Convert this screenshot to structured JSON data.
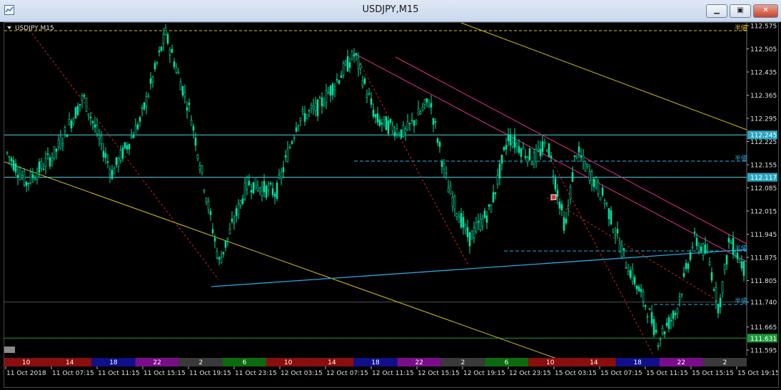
{
  "window": {
    "title": "USDJPY,M15",
    "minimize_icon": "minimize-icon",
    "maximize_icon": "restore-icon",
    "close_icon": "close-icon"
  },
  "chart": {
    "symbol_label": "USDJPY,M15",
    "colors": {
      "background": "#000000",
      "bull": "#00e0a0",
      "bear": "#00e0a0",
      "hline": "#4fd6e6",
      "trend_blue": "#2aa7e0",
      "channel_pink": "#e0308a",
      "channel_yellow": "#d8c020",
      "fib_red": "#d02020",
      "dash_cyan": "#28b0d8",
      "dash_yellow": "#e0c020"
    },
    "price_labels": [
      "112.575",
      "112.505",
      "112.435",
      "112.365",
      "112.295",
      "112.225",
      "112.155",
      "112.085",
      "112.015",
      "111.945",
      "111.875",
      "111.805",
      "111.740",
      "111.665",
      "111.595"
    ],
    "highlight_labels": [
      {
        "text": "112.245",
        "price": 112.245,
        "color": "#2aa7c0"
      },
      {
        "text": "112.117",
        "price": 112.117,
        "color": "#2aa7c0"
      },
      {
        "text": "111.631",
        "price": 111.631,
        "color": "#1e9a3a"
      }
    ],
    "marker_labels": [
      "半値",
      "半値",
      "半値",
      "半値"
    ],
    "time_labels": [
      "11 Oct 2018",
      "11 Oct 07:15",
      "11 Oct 11:15",
      "11 Oct 15:15",
      "11 Oct 19:15",
      "11 Oct 23:15",
      "12 Oct 03:15",
      "12 Oct 07:15",
      "12 Oct 11:15",
      "12 Oct 15:15",
      "12 Oct 19:15",
      "12 Oct 23:15",
      "15 Oct 03:15",
      "15 Oct 07:15",
      "15 Oct 11:15",
      "15 Oct 15:15",
      "15 Oct 19:15"
    ],
    "session_bar": [
      {
        "label": "10",
        "color": "#8a0e0e"
      },
      {
        "label": "14",
        "color": "#8a0e0e"
      },
      {
        "label": "18",
        "color": "#10108a"
      },
      {
        "label": "22",
        "color": "#7a0e8a"
      },
      {
        "label": "2",
        "color": "#3a3a3a"
      },
      {
        "label": "6",
        "color": "#0e6a0e"
      },
      {
        "label": "10",
        "color": "#8a0e0e"
      },
      {
        "label": "14",
        "color": "#8a0e0e"
      },
      {
        "label": "18",
        "color": "#10108a"
      },
      {
        "label": "22",
        "color": "#7a0e8a"
      },
      {
        "label": "2",
        "color": "#3a3a3a"
      },
      {
        "label": "6",
        "color": "#0e6a0e"
      },
      {
        "label": "10",
        "color": "#8a0e0e"
      },
      {
        "label": "14",
        "color": "#8a0e0e"
      },
      {
        "label": "18",
        "color": "#10108a"
      },
      {
        "label": "22",
        "color": "#7a0e8a"
      },
      {
        "label": "2",
        "color": "#3a3a3a"
      }
    ]
  }
}
